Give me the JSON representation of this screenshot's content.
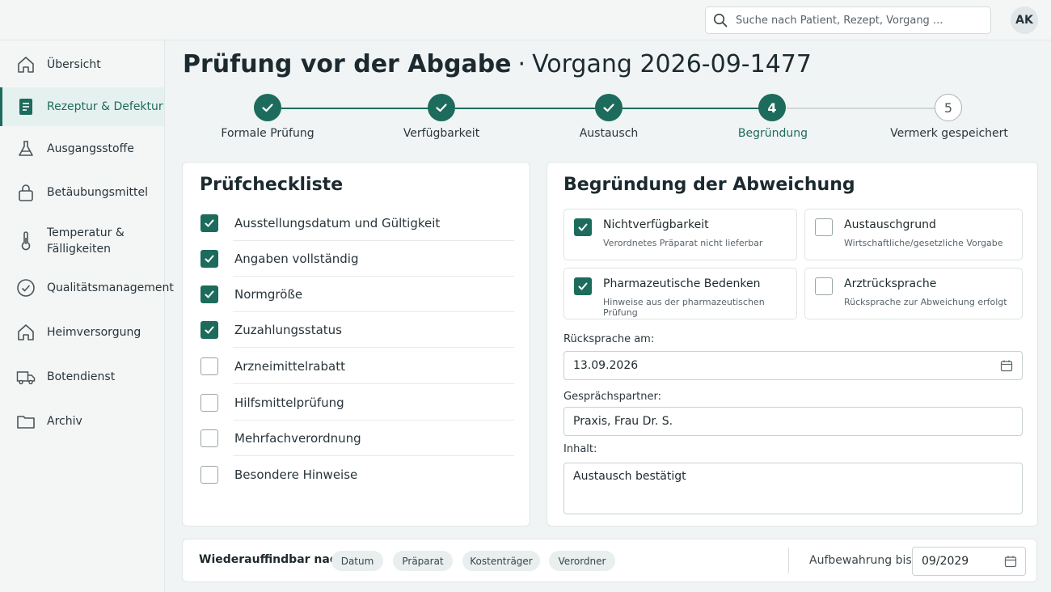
{
  "search": {
    "placeholder": "Suche nach Patient, Rezept, Vorgang ..."
  },
  "user": {
    "initials": "AK"
  },
  "sidebar": {
    "items": [
      {
        "label": "Übersicht",
        "icon": "home-icon"
      },
      {
        "label": "Rezeptur & Defektur",
        "icon": "document-icon",
        "active": true
      },
      {
        "label": "Ausgangsstoffe",
        "icon": "flask-icon"
      },
      {
        "label": "Betäubungsmittel",
        "icon": "lock-icon"
      },
      {
        "label": "Temperatur & Fälligkeiten",
        "icon": "thermometer-icon"
      },
      {
        "label": "Qualitätsmanagement",
        "icon": "check-circle-icon"
      },
      {
        "label": "Heimversorgung",
        "icon": "house-icon"
      },
      {
        "label": "Botendienst",
        "icon": "truck-icon"
      },
      {
        "label": "Archiv",
        "icon": "folder-icon"
      }
    ]
  },
  "header": {
    "title": "Prüfung vor der Abgabe",
    "separator": "·",
    "subtitle": "Vorgang 2026-09-1477"
  },
  "stepper": {
    "steps": [
      {
        "label": "Formale Prüfung",
        "status": "done"
      },
      {
        "label": "Verfügbarkeit",
        "status": "done"
      },
      {
        "label": "Austausch",
        "status": "done"
      },
      {
        "label": "Begründung",
        "status": "current",
        "number": "4"
      },
      {
        "label": "Vermerk gespeichert",
        "status": "todo",
        "number": "5"
      }
    ]
  },
  "checklist": {
    "title": "Prüfcheckliste",
    "items": [
      {
        "label": "Ausstellungsdatum und Gültigkeit",
        "checked": true
      },
      {
        "label": "Angaben vollständig",
        "checked": true
      },
      {
        "label": "Normgröße",
        "checked": true
      },
      {
        "label": "Zuzahlungsstatus",
        "checked": true
      },
      {
        "label": "Arzneimittelrabatt",
        "checked": false
      },
      {
        "label": "Hilfsmittelprüfung",
        "checked": false
      },
      {
        "label": "Mehrfachverordnung",
        "checked": false
      },
      {
        "label": "Besondere Hinweise",
        "checked": false
      }
    ]
  },
  "reason": {
    "title": "Begründung der Abweichung",
    "options": [
      {
        "title": "Nichtverfügbarkeit",
        "subtitle": "Verordnetes Präparat nicht lieferbar",
        "checked": true
      },
      {
        "title": "Austauschgrund",
        "subtitle": "Wirtschaftliche/gesetzliche Vorgabe",
        "checked": false
      },
      {
        "title": "Pharmazeutische Bedenken",
        "subtitle": "Hinweise aus der pharmazeutischen Prüfung",
        "checked": true
      },
      {
        "title": "Arztrücksprache",
        "subtitle": "Rücksprache zur Abweichung erfolgt",
        "checked": false
      }
    ],
    "date_label": "Rücksprache am:",
    "date_value": "13.09.2026",
    "partner_label": "Gesprächspartner:",
    "partner_value": "Praxis, Frau Dr. S.",
    "content_label": "Inhalt:",
    "content_value": "Austausch bestätigt"
  },
  "bottom": {
    "label": "Wiederauffindbar nach:",
    "chips": [
      "Datum",
      "Präparat",
      "Kostenträger",
      "Verordner"
    ],
    "keep_label": "Aufbewahrung bis",
    "keep_value": "09/2029"
  },
  "colors": {
    "accent": "#1d6b5c",
    "active_bg": "#e5f1ee",
    "background": "#f1f4f4"
  }
}
